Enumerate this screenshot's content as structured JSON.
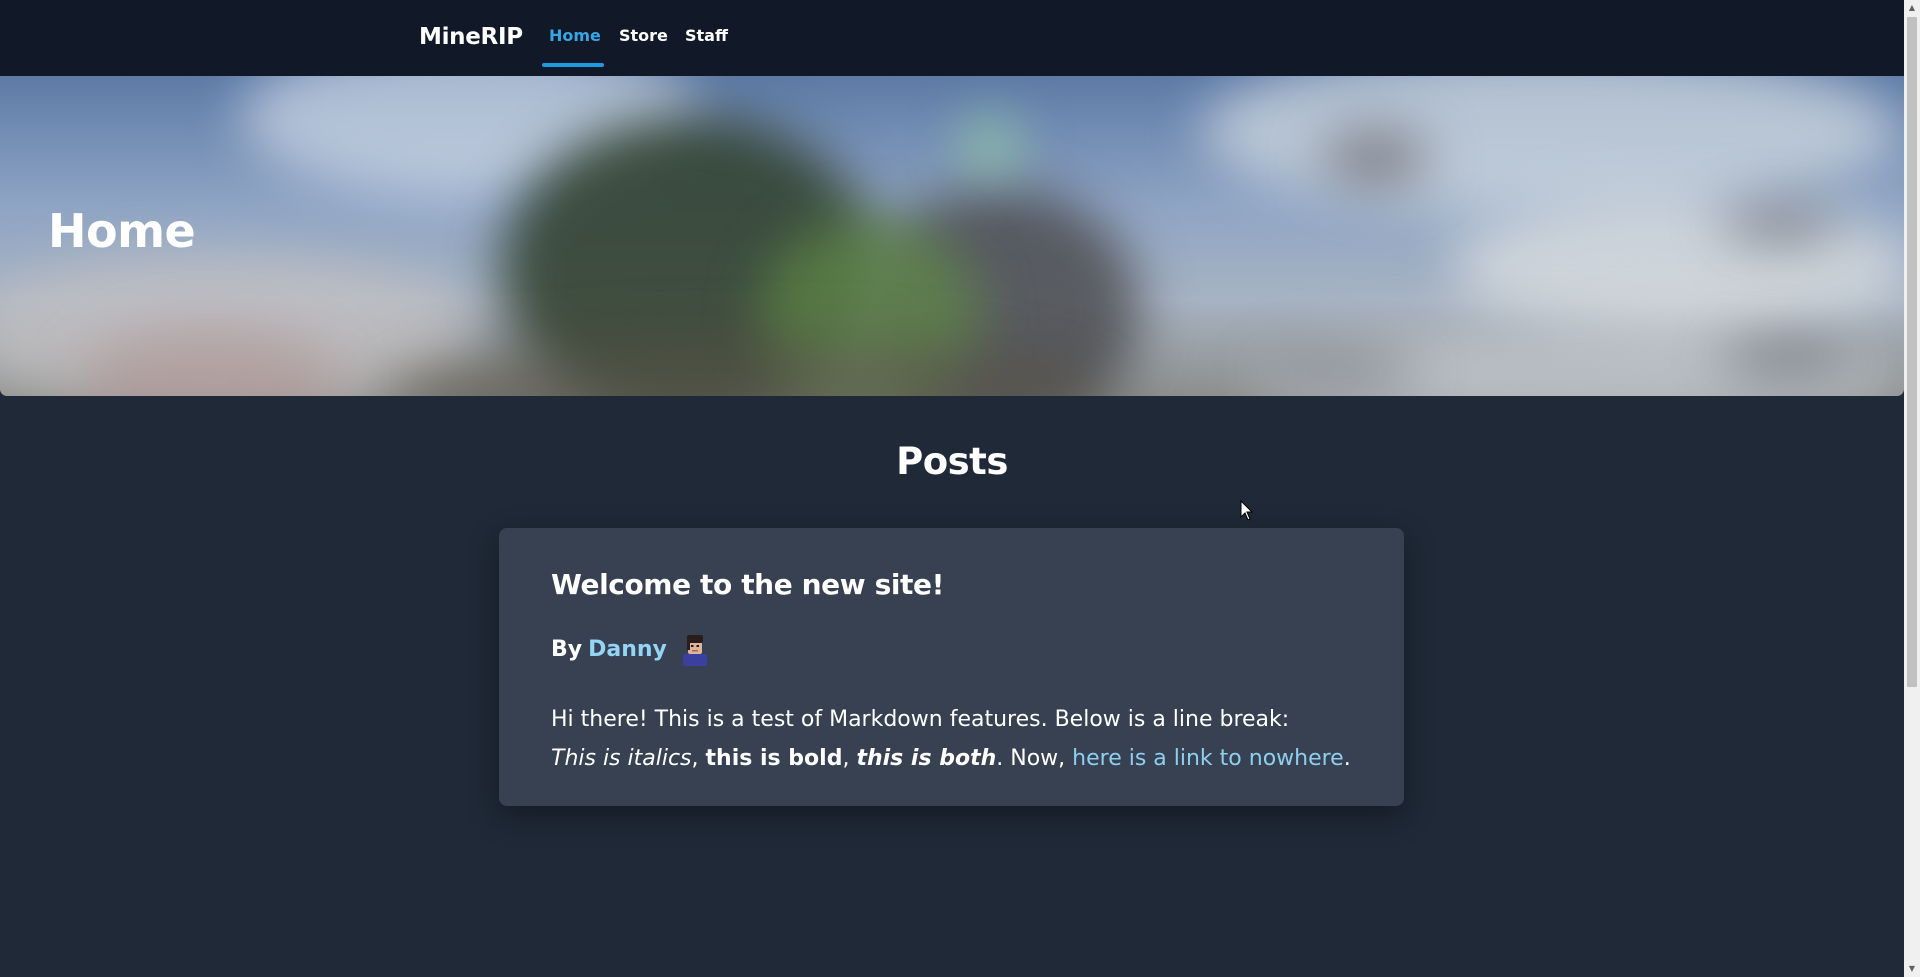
{
  "header": {
    "brand": "MineRIP",
    "nav": [
      {
        "label": "Home",
        "active": true
      },
      {
        "label": "Store",
        "active": false
      },
      {
        "label": "Staff",
        "active": false
      }
    ]
  },
  "hero": {
    "title": "Home"
  },
  "posts_section": {
    "title": "Posts"
  },
  "posts": [
    {
      "title": "Welcome to the new site!",
      "by_label": "By",
      "author": "Danny",
      "body": {
        "intro": "Hi there! This is a test of Markdown features. Below is a line break:",
        "italic": "This is italics",
        "sep1": ", ",
        "bold": "this is bold",
        "sep2": ", ",
        "bold_italic": "this is both",
        "mid": ". Now, ",
        "link": "here is a link to nowhere",
        "end": "."
      }
    }
  ],
  "colors": {
    "header_bg": "#111827",
    "page_bg": "#1f2937",
    "card_bg": "#374151",
    "accent": "#38a6e6",
    "link": "#8ecfef"
  },
  "icons": [
    "user-avatar-icon",
    "mouse-cursor-icon",
    "scroll-up-arrow-icon",
    "scroll-down-arrow-icon"
  ]
}
